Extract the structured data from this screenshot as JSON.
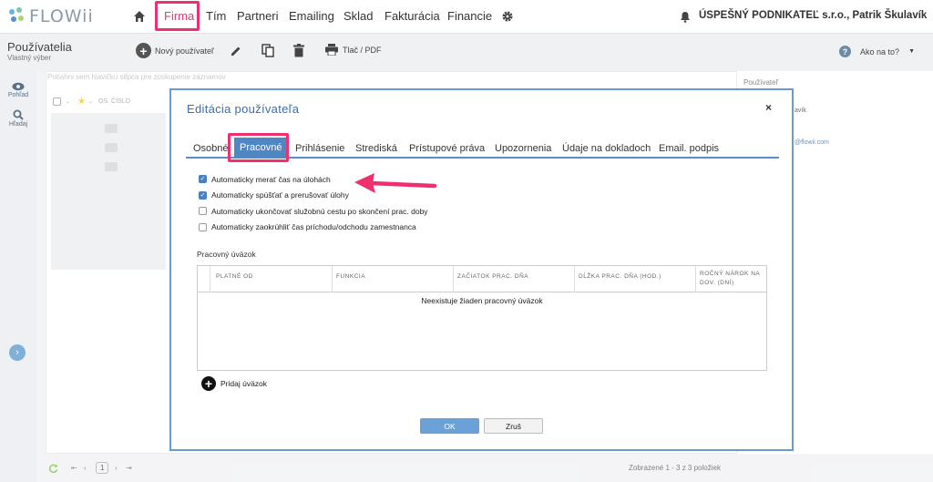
{
  "app": {
    "logo": "FLOWii"
  },
  "nav": {
    "items": [
      "Firma",
      "Tím",
      "Partneri",
      "Emailing",
      "Sklad",
      "Fakturácia",
      "Financie"
    ],
    "active": "Firma",
    "company_user": "ÚSPEŠNÝ PODNIKATEĽ s.r.o., Patrik Škulavík"
  },
  "page": {
    "title": "Používatelia",
    "subtitle": "Vlastný výber",
    "toolbar": {
      "new_user": "Nový používateľ",
      "print": "Tlač / PDF"
    },
    "help": "Ako na to?"
  },
  "sidebar": {
    "view": "Pohľad",
    "search": "Hľadaj"
  },
  "background": {
    "group_hint": "Potiahni sem hlavičku stĺpca pre zoskupenie záznamov",
    "col_number": "OS. ČÍSLO",
    "right_header": "Používateľ",
    "right_line1": "avík",
    "right_line2": "@flowii.com",
    "pager_page": "1",
    "pager_info": "Zobrazené 1 - 3 z 3 položiek"
  },
  "modal": {
    "title": "Editácia používateľa",
    "close": "×",
    "tabs": [
      "Osobné",
      "Pracovné",
      "Prihlásenie",
      "Strediská",
      "Prístupové práva",
      "Upozornenia",
      "Údaje na dokladoch",
      "Email. podpis"
    ],
    "active_tab": "Pracovné",
    "checkboxes": [
      {
        "label": "Automaticky merať čas na úlohách",
        "checked": true
      },
      {
        "label": "Automaticky spúšťať a prerušovať úlohy",
        "checked": true
      },
      {
        "label": "Automaticky ukončovať služobnú cestu po skončení prac. doby",
        "checked": false
      },
      {
        "label": "Automaticky zaokrúhliť čas príchodu/odchodu zamestnanca",
        "checked": false
      }
    ],
    "section_title": "Pracovný úväzok",
    "table_headers": [
      "PLATNÉ OD",
      "FUNKCIA",
      "ZAČIATOK PRAC. DŇA",
      "DĹŽKA PRAC. DŇA (HOD.)",
      "ROČNÝ NÁROK NA DOV. (DNÍ)"
    ],
    "empty_message": "Neexistuje žiaden pracovný úväzok",
    "add_label": "Pridaj úväzok",
    "ok": "OK",
    "cancel": "Zruš"
  },
  "colors": {
    "accent": "#e8356d",
    "highlight_box": "#f0306e",
    "primary": "#4e87c4",
    "modal_border": "#6a9bd0"
  }
}
